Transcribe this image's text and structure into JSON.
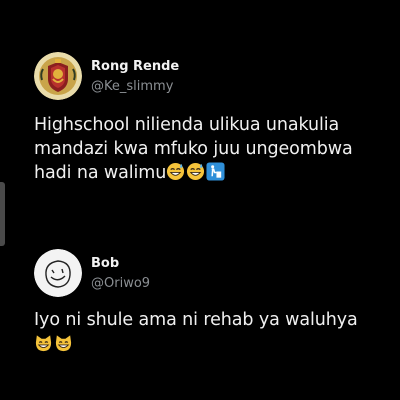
{
  "tweets": [
    {
      "display_name": "Rong Rende",
      "handle": "@Ke_slimmy",
      "avatar_icon": "lion-crest-avatar-icon",
      "text": "Highschool nilienda ulikua unakulia mandazi kwa mfuko juu ungeombwa hadi na walimu",
      "emojis": [
        "grinning-sweat-icon",
        "grinning-sweat-icon",
        "person-litter-bin-icon"
      ]
    },
    {
      "display_name": "Bob",
      "handle": "@Oriwo9",
      "avatar_icon": "smiley-sketch-avatar-icon",
      "text": "Iyo ni shule ama ni rehab ya waluhya",
      "emojis": [
        "grinning-cat-icon",
        "grinning-cat-icon"
      ]
    }
  ],
  "colors": {
    "background": "#000000",
    "text": "#f0f0f0",
    "handle": "#8b8f93"
  }
}
